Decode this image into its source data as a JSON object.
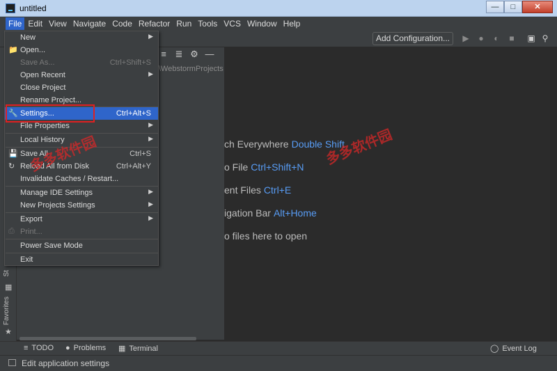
{
  "window": {
    "title": "untitled"
  },
  "menubar": [
    "File",
    "Edit",
    "View",
    "Navigate",
    "Code",
    "Refactor",
    "Run",
    "Tools",
    "VCS",
    "Window",
    "Help"
  ],
  "toolbar": {
    "add_configuration": "Add Configuration..."
  },
  "project": {
    "path": "\\WebstormProjects"
  },
  "file_menu": {
    "new": "New",
    "open": "Open...",
    "save_as": "Save As...",
    "save_as_shortcut": "Ctrl+Shift+S",
    "open_recent": "Open Recent",
    "close_project": "Close Project",
    "rename_project": "Rename Project...",
    "settings": "Settings...",
    "settings_shortcut": "Ctrl+Alt+S",
    "file_properties": "File Properties",
    "local_history": "Local History",
    "save_all": "Save All",
    "save_all_shortcut": "Ctrl+S",
    "reload": "Reload All from Disk",
    "reload_shortcut": "Ctrl+Alt+Y",
    "invalidate": "Invalidate Caches / Restart...",
    "manage_ide": "Manage IDE Settings",
    "new_projects": "New Projects Settings",
    "export": "Export",
    "print": "Print...",
    "power_save": "Power Save Mode",
    "exit": "Exit"
  },
  "editor_hints": [
    {
      "text": "ch Everywhere",
      "key": "Double Shift"
    },
    {
      "text": "o File",
      "key": "Ctrl+Shift+N"
    },
    {
      "text": "ent Files",
      "key": "Ctrl+E"
    },
    {
      "text": "igation Bar",
      "key": "Alt+Home"
    },
    {
      "text": "o files here to open",
      "key": ""
    }
  ],
  "left_tabs": {
    "structure": "St",
    "favorites": "Favorites"
  },
  "bottom_tabs": {
    "todo": "TODO",
    "problems": "Problems",
    "terminal": "Terminal",
    "event_log": "Event Log"
  },
  "status": {
    "text": "Edit application settings"
  },
  "watermark": "多多软件园",
  "colors": {
    "accent": "#2f65ca",
    "highlight": "#e02020",
    "link": "#589df6"
  }
}
